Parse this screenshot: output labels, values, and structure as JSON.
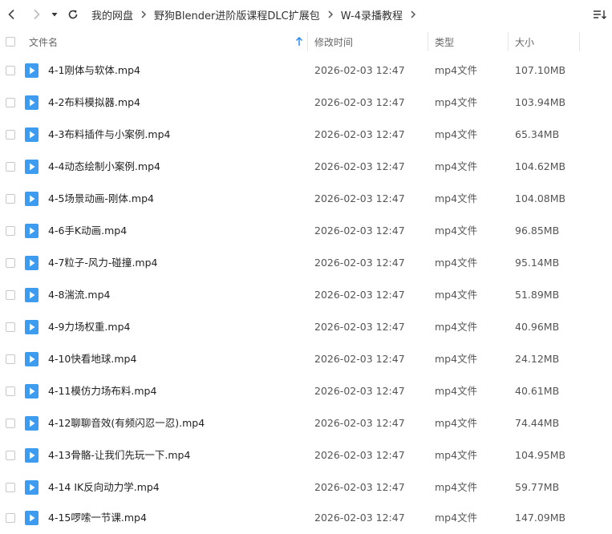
{
  "breadcrumb": [
    "我的网盘",
    "野狗Blender进阶版课程DLC扩展包",
    "W-4录播教程"
  ],
  "columns": {
    "name": "文件名",
    "modified": "修改时间",
    "type": "类型",
    "size": "大小"
  },
  "files": [
    {
      "name": "4-1刚体与软体.mp4",
      "modified": "2026-02-03 12:47",
      "type": "mp4文件",
      "size": "107.10MB"
    },
    {
      "name": "4-2布料模拟器.mp4",
      "modified": "2026-02-03 12:47",
      "type": "mp4文件",
      "size": "103.94MB"
    },
    {
      "name": "4-3布料插件与小案例.mp4",
      "modified": "2026-02-03 12:47",
      "type": "mp4文件",
      "size": "65.34MB"
    },
    {
      "name": "4-4动态绘制小案例.mp4",
      "modified": "2026-02-03 12:47",
      "type": "mp4文件",
      "size": "104.62MB"
    },
    {
      "name": "4-5场景动画-刚体.mp4",
      "modified": "2026-02-03 12:47",
      "type": "mp4文件",
      "size": "104.08MB"
    },
    {
      "name": "4-6手K动画.mp4",
      "modified": "2026-02-03 12:47",
      "type": "mp4文件",
      "size": "96.85MB"
    },
    {
      "name": "4-7粒子-风力-碰撞.mp4",
      "modified": "2026-02-03 12:47",
      "type": "mp4文件",
      "size": "95.14MB"
    },
    {
      "name": "4-8湍流.mp4",
      "modified": "2026-02-03 12:47",
      "type": "mp4文件",
      "size": "51.89MB"
    },
    {
      "name": "4-9力场权重.mp4",
      "modified": "2026-02-03 12:47",
      "type": "mp4文件",
      "size": "40.96MB"
    },
    {
      "name": "4-10快看地球.mp4",
      "modified": "2026-02-03 12:47",
      "type": "mp4文件",
      "size": "24.12MB"
    },
    {
      "name": "4-11模仿力场布料.mp4",
      "modified": "2026-02-03 12:47",
      "type": "mp4文件",
      "size": "40.61MB"
    },
    {
      "name": "4-12聊聊音效(有频闪忍一忍).mp4",
      "modified": "2026-02-03 12:47",
      "type": "mp4文件",
      "size": "74.44MB"
    },
    {
      "name": "4-13骨骼-让我们先玩一下.mp4",
      "modified": "2026-02-03 12:47",
      "type": "mp4文件",
      "size": "104.95MB"
    },
    {
      "name": "4-14 IK反向动力学.mp4",
      "modified": "2026-02-03 12:47",
      "type": "mp4文件",
      "size": "59.77MB"
    },
    {
      "name": "4-15啰嗦一节课.mp4",
      "modified": "2026-02-03 12:47",
      "type": "mp4文件",
      "size": "147.09MB"
    }
  ],
  "colors": {
    "accent": "#2b8cf2",
    "video_icon": "#3d9cf0"
  }
}
